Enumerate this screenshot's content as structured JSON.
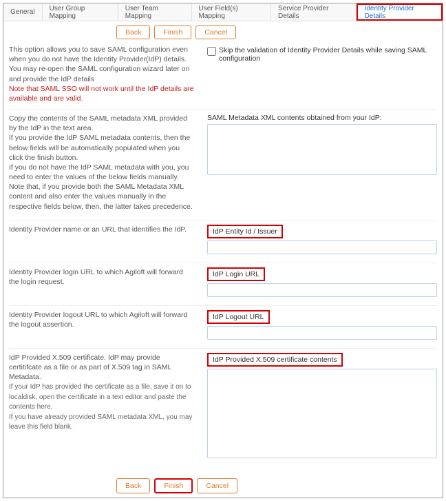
{
  "tabs": {
    "general": "General",
    "user_group": "User Group Mapping",
    "user_team": "User Team Mapping",
    "user_fields": "User Field(s) Mapping",
    "service_provider": "Service Provider Details",
    "identity_provider": "Identity Provider Details"
  },
  "buttons": {
    "back": "Back",
    "finish": "Finish",
    "cancel": "Cancel"
  },
  "top": {
    "opt1": "This option allows you to save SAML configuration even when you do not have the Identity Provider(IdP) details.",
    "opt2": "You may re-open the SAML configuration wizard later on and provide the IdP details",
    "warn": "Note that SAML SSO will not work until the IdP details are available and are valid.",
    "skip": "Skip the validation of Identity Provider Details while saving SAML configuration"
  },
  "metadata": {
    "desc1": "Copy the contents of the SAML metadata XML provided by the IdP in the text area.",
    "desc2": "If you provide the IdP SAML metadata contents, then the below fields will be automatically populated when you click the finish button.",
    "desc3": "If you do not have the IdP SAML metadata with you, you need to enter the values of the below fields manually.",
    "desc4": "Note that, if you provide both the SAML Metadata XML content and also enter the values manually in the respective fields below, then, the latter takes precedence.",
    "label": "SAML Metadata XML contents obtained from your IdP:"
  },
  "fields": {
    "entity": {
      "desc": "Identity Provider name or an URL that identifies the IdP.",
      "label": "IdP Entity Id / Issuer"
    },
    "login": {
      "desc": "Identity Provider login URL to which Agiloft will forward the login request.",
      "label": "IdP Login URL"
    },
    "logout": {
      "desc": "Identity Provider logout URL to which Agiloft will forward the logout assertion.",
      "label": "IdP Logout URL"
    },
    "cert": {
      "desc": "IdP Provided X.509 certificate. IdP may provide certitifcate as a file or as part of X.509 tag in SAML Metadata.",
      "sub1": "If your IdP has provided the certificate as a file, save it on to localdisk, open the certificate in a text editor and paste the contents here.",
      "sub2": "If you have already provided SAML metadata XML, you may leave this field blank.",
      "label": "IdP Provided X.509 certificate contents"
    }
  }
}
